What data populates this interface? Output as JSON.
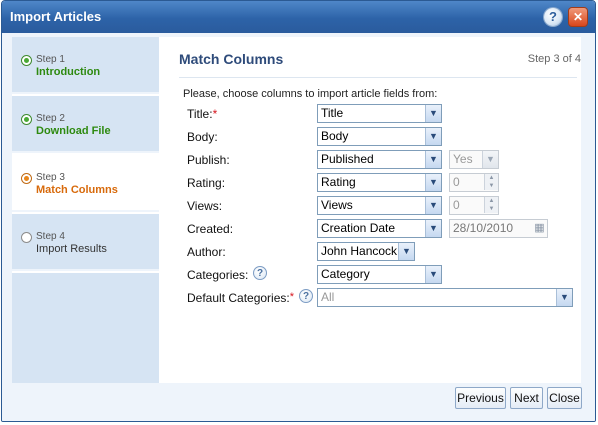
{
  "window": {
    "title": "Import Articles",
    "help_icon": "question-icon",
    "close_icon": "x-icon",
    "help_glyph": "?",
    "close_glyph": "✕"
  },
  "steps": [
    {
      "num": "Step 1",
      "name": "Introduction",
      "state": "done"
    },
    {
      "num": "Step 2",
      "name": "Download File",
      "state": "done"
    },
    {
      "num": "Step 3",
      "name": "Match Columns",
      "state": "current"
    },
    {
      "num": "Step 4",
      "name": "Import Results",
      "state": "pending"
    }
  ],
  "main": {
    "title": "Match Columns",
    "step_of": "Step 3 of 4",
    "intro": "Please, choose columns to import article fields from:"
  },
  "fields": {
    "title": {
      "label": "Title:",
      "required_mark": "*",
      "value": "Title"
    },
    "body": {
      "label": "Body:",
      "value": "Body"
    },
    "publish": {
      "label": "Publish:",
      "value": "Published",
      "default": "Yes"
    },
    "rating": {
      "label": "Rating:",
      "value": "Rating",
      "default": "0"
    },
    "views": {
      "label": "Views:",
      "value": "Views",
      "default": "0"
    },
    "created": {
      "label": "Created:",
      "value": "Creation Date",
      "default": "28/10/2010"
    },
    "author": {
      "label": "Author:",
      "value": "John Hancock"
    },
    "categories": {
      "label": "Categories:",
      "value": "Category"
    },
    "default_categories": {
      "label": "Default Categories:",
      "required_mark": "*",
      "value": "All"
    }
  },
  "glyphs": {
    "dropdown": "▼",
    "spin_up": "▲",
    "spin_down": "▼",
    "help": "?",
    "calendar": "▦"
  },
  "footer": {
    "previous": "Previous",
    "next": "Next",
    "close": "Close"
  },
  "colors": {
    "titlebar": "#2d63a8",
    "done_step": "#2e8a10",
    "current_step": "#d86a0b",
    "required": "#d6141c",
    "heading": "#2e4b7a"
  }
}
